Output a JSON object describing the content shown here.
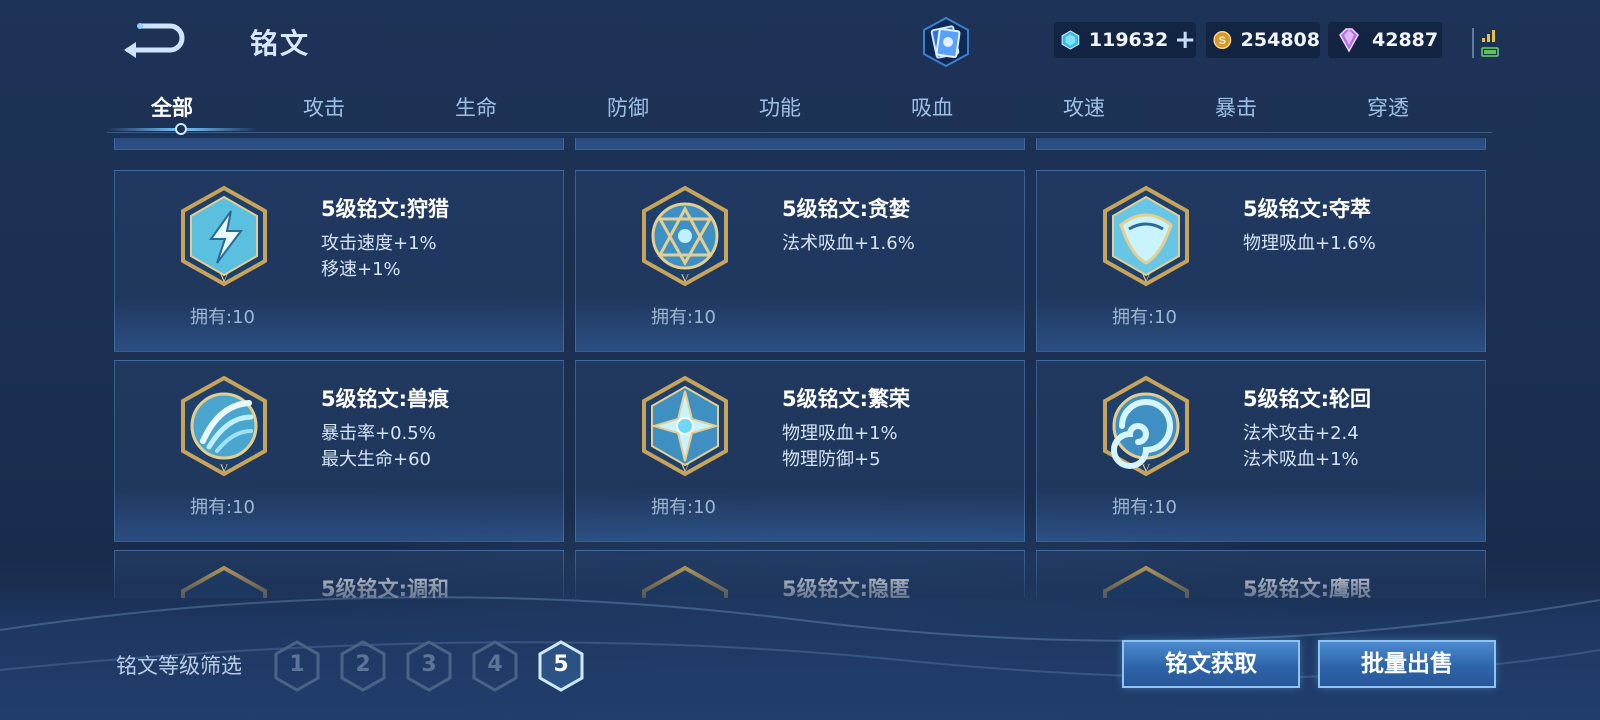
{
  "header": {
    "title": "铭文",
    "back_icon": "back-arrow-icon",
    "deck_icon": "rune-book-icon"
  },
  "currencies": [
    {
      "icon": "blue-diamond-icon",
      "amount": "119632",
      "color": "#4fd0f0"
    },
    {
      "icon": "gold-coin-icon",
      "amount": "254808",
      "color": "#e0a23a"
    },
    {
      "icon": "purple-gem-icon",
      "amount": "42887",
      "color": "#c27df0"
    }
  ],
  "tabs": [
    {
      "label": "全部",
      "active": true
    },
    {
      "label": "攻击"
    },
    {
      "label": "生命"
    },
    {
      "label": "防御"
    },
    {
      "label": "功能"
    },
    {
      "label": "吸血"
    },
    {
      "label": "攻速"
    },
    {
      "label": "暴击"
    },
    {
      "label": "穿透"
    }
  ],
  "runes": [
    {
      "name": "5级铭文:狩猎",
      "attrs": [
        "攻击速度+1%",
        "移速+1%"
      ],
      "owned": "拥有:10",
      "emblem": "lightning-rune-icon"
    },
    {
      "name": "5级铭文:贪婪",
      "attrs": [
        "法术吸血+1.6%"
      ],
      "owned": "拥有:10",
      "emblem": "triangle-rune-icon"
    },
    {
      "name": "5级铭文:夺萃",
      "attrs": [
        "物理吸血+1.6%"
      ],
      "owned": "拥有:10",
      "emblem": "crescent-rune-icon"
    },
    {
      "name": "5级铭文:兽痕",
      "attrs": [
        "暴击率+0.5%",
        "最大生命+60"
      ],
      "owned": "拥有:10",
      "emblem": "claw-rune-icon"
    },
    {
      "name": "5级铭文:繁荣",
      "attrs": [
        "物理吸血+1%",
        "物理防御+5"
      ],
      "owned": "拥有:10",
      "emblem": "star-rune-icon"
    },
    {
      "name": "5级铭文:轮回",
      "attrs": [
        "法术攻击+2.4",
        "法术吸血+1%"
      ],
      "owned": "拥有:10",
      "emblem": "spiral-rune-icon"
    },
    {
      "name": "5级铭文:调和",
      "attrs": [],
      "owned": "",
      "emblem": "rune-icon"
    },
    {
      "name": "5级铭文:隐匿",
      "attrs": [],
      "owned": "",
      "emblem": "rune-icon"
    },
    {
      "name": "5级铭文:鹰眼",
      "attrs": [],
      "owned": "",
      "emblem": "rune-icon"
    }
  ],
  "filter": {
    "label": "铭文等级筛选",
    "levels": [
      "1",
      "2",
      "3",
      "4",
      "5"
    ],
    "selected": "5"
  },
  "buttons": {
    "get": "铭文获取",
    "sell": "批量出售"
  }
}
